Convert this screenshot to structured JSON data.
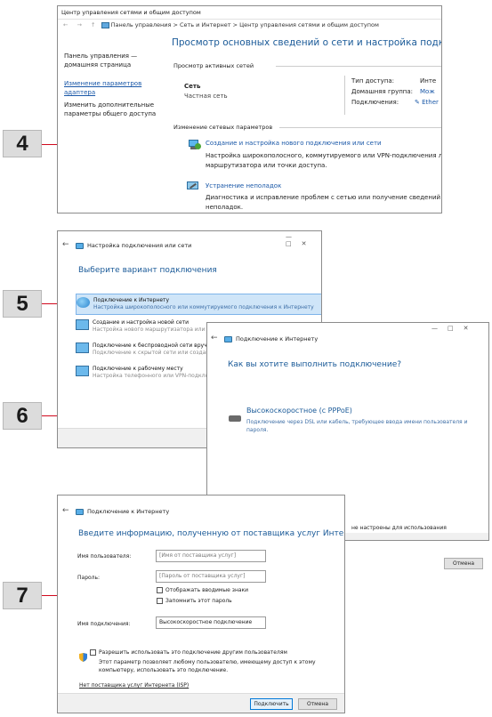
{
  "steps": [
    "4",
    "5",
    "6",
    "7"
  ],
  "accent": "#d0091e",
  "shot1": {
    "window_title": "Центр управления сетями и общим доступом",
    "nav_arrows": "← → ↑",
    "breadcrumb": "Панель управления > Сеть и Интернет > Центр управления сетями и общим доступом",
    "sidebar": {
      "home": "Панель управления —",
      "home2": "домашняя страница",
      "adapter": "Изменение параметров",
      "adapter2": "адаптера",
      "sharing": "Изменить дополнительные",
      "sharing2": "параметры общего доступа"
    },
    "heading": "Просмотр основных сведений о сети и настройка подключений",
    "active_networks": "Просмотр активных сетей",
    "network_name": "Сеть",
    "network_type": "Частная сеть",
    "access_type_label": "Тип доступа:",
    "access_type_value": "Инте",
    "homegroup_label": "Домашняя группа:",
    "homegroup_value": "Мож",
    "connections_label": "Подключения:",
    "connections_value": "Ether",
    "change_settings": "Изменение сетевых параметров",
    "create_link": "Создание и настройка нового подключения или сети",
    "create_desc1": "Настройка широкополосного, коммутируемого или VPN-подключения ли",
    "create_desc2": "маршрутизатора или точки доступа.",
    "troubleshoot_link": "Устранение неполадок",
    "troubleshoot_desc1": "Диагностика и исправление проблем с сетью или получение сведений об",
    "troubleshoot_desc2": "неполадок."
  },
  "shot2": {
    "header": "Настройка подключения или сети",
    "title": "Выберите вариант подключения",
    "options": [
      {
        "title": "Подключение к Интернету",
        "desc": "Настройка широкополосного или коммутируемого подключения к Интернету"
      },
      {
        "title": "Создание и настройка новой сети",
        "desc": "Настройка нового маршрутизатора или точки доступа."
      },
      {
        "title": "Подключение к беспроводной сети вручную",
        "desc": "Подключение к скрытой сети или создан"
      },
      {
        "title": "Подключение к рабочему месту",
        "desc": "Настройка телефонного или VPN-подклю"
      }
    ]
  },
  "shot3": {
    "header": "Подключение к Интернету",
    "title": "Как вы хотите выполнить подключение?",
    "option_title": "Высокоскоростное (с PPPoE)",
    "option_desc1": "Подключение через DSL или кабель, требующее ввода имени пользователя и",
    "option_desc2": "пароля.",
    "bottom_note": "не настроены для использования",
    "cancel": "Отмена"
  },
  "shot4": {
    "header": "Подключение к Интернету",
    "title": "Введите информацию, полученную от поставщика услуг Интернета",
    "username_label": "Имя пользователя:",
    "username_placeholder": "[Имя от поставщика услуг]",
    "password_label": "Пароль:",
    "password_placeholder": "[Пароль от поставщика услуг]",
    "show_chars": "Отображать вводимые знаки",
    "remember": "Запомнить этот пароль",
    "connection_name_label": "Имя подключения:",
    "connection_name_value": "Высокоскоростное подключение",
    "allow_others": "Разрешить использовать это подключение другим пользователям",
    "allow_desc1": "Этот параметр позволяет любому пользователю, имеющему доступ к этому",
    "allow_desc2": "компьютеру, использовать это подключение.",
    "no_isp": "Нет поставщика услуг Интернета (ISP)",
    "connect": "Подключить",
    "cancel": "Отмена"
  }
}
